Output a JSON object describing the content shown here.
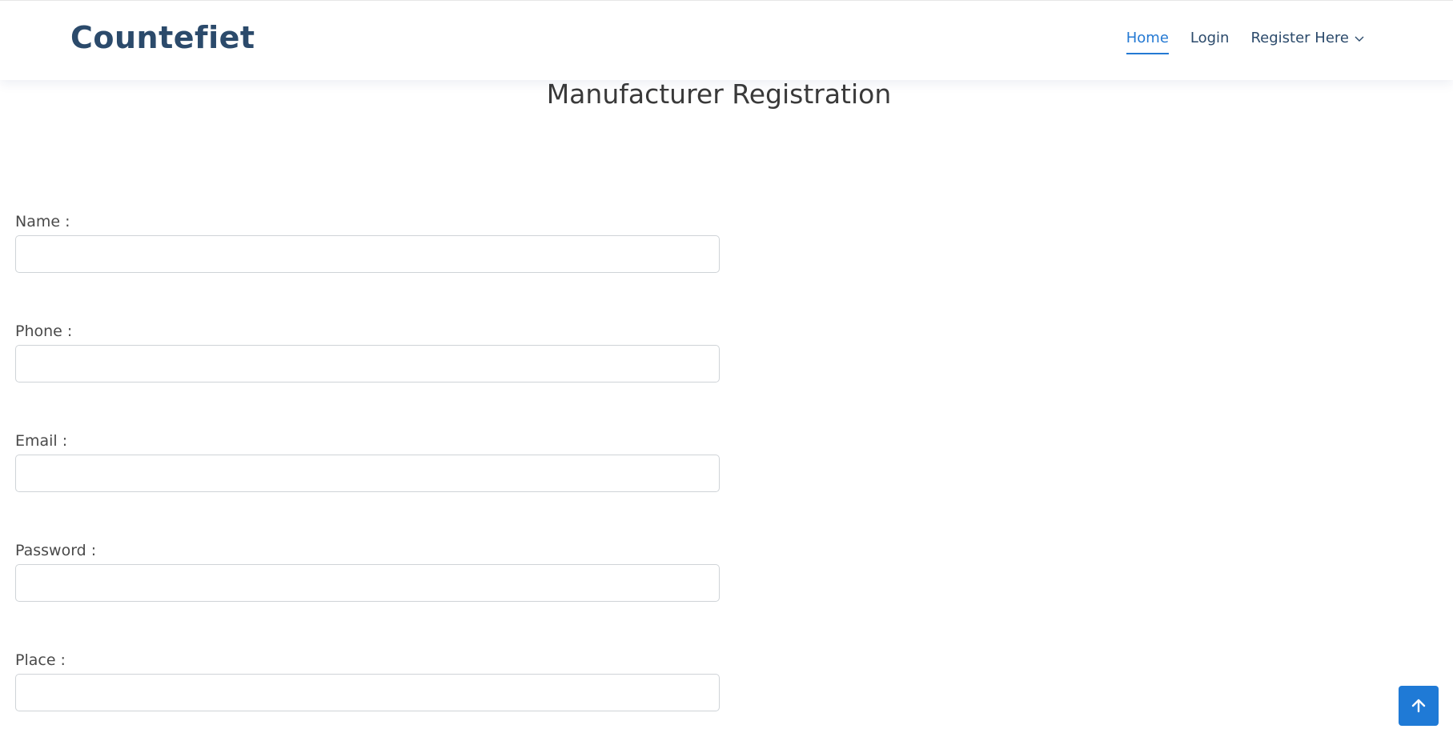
{
  "header": {
    "logo": "Countefiet",
    "nav": [
      {
        "label": "Home",
        "active": true
      },
      {
        "label": "Login",
        "active": false
      },
      {
        "label": "Register Here",
        "active": false,
        "dropdown": true
      }
    ]
  },
  "page": {
    "title": "Manufacturer Registration"
  },
  "form": {
    "fields": [
      {
        "label": "Name :",
        "value": "",
        "placeholder": ""
      },
      {
        "label": "Phone :",
        "value": "",
        "placeholder": ""
      },
      {
        "label": "Email :",
        "value": "",
        "placeholder": ""
      },
      {
        "label": "Password :",
        "value": "",
        "placeholder": ""
      },
      {
        "label": "Place :",
        "value": "",
        "placeholder": ""
      }
    ]
  },
  "back_to_top": {
    "icon": "arrow-up-icon"
  },
  "colors": {
    "accent": "#1f7ad6",
    "brand": "#2b4a6b",
    "active_nav": "#2479d3"
  }
}
